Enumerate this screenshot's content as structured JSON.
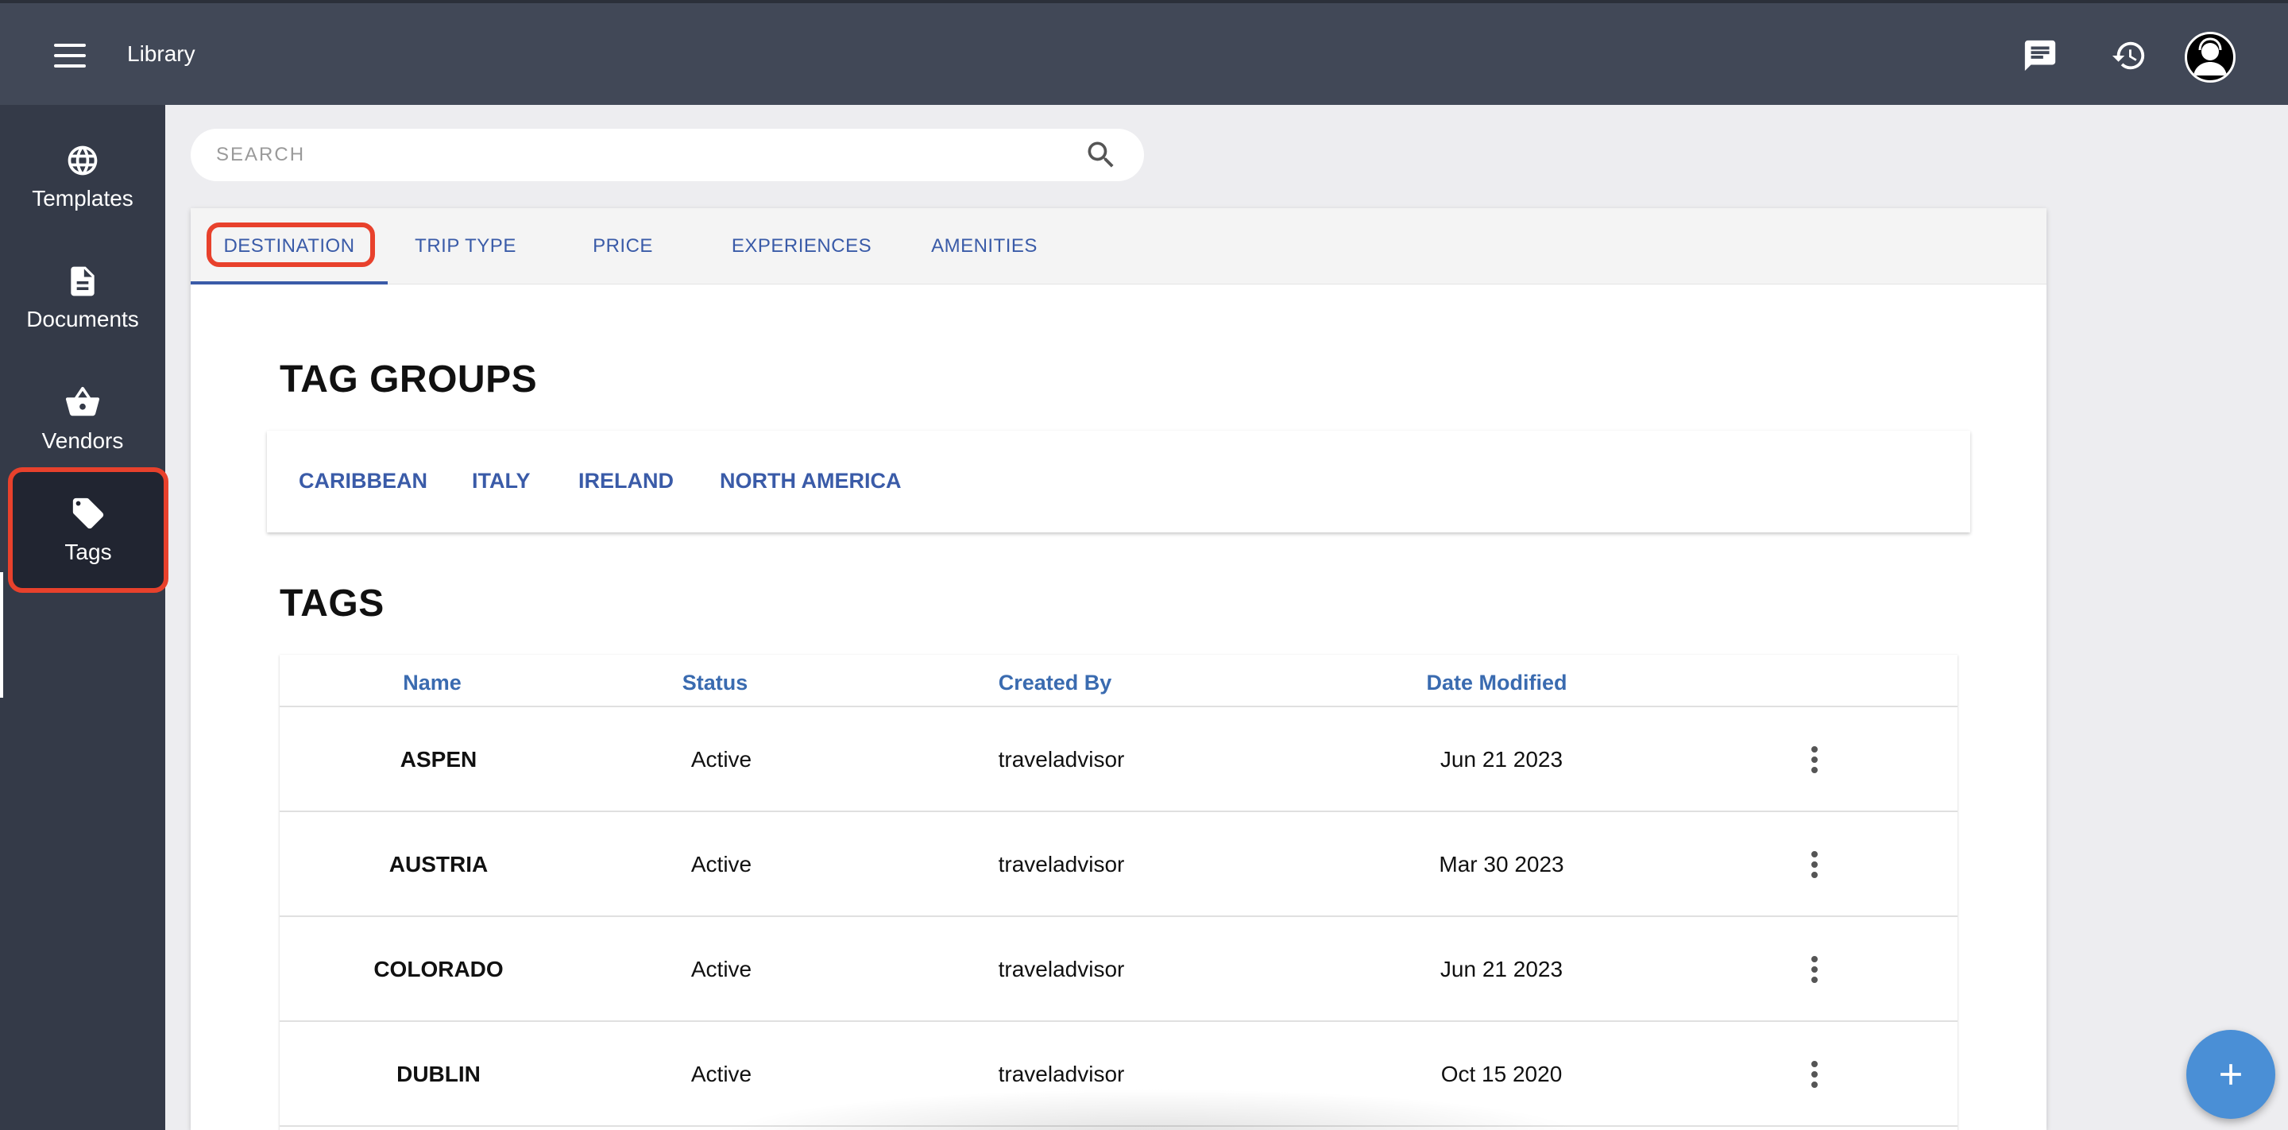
{
  "app": {
    "title": "Library"
  },
  "header": {
    "icons": [
      "menu-icon",
      "chat-icon",
      "history-icon",
      "user-avatar"
    ]
  },
  "sidebar": {
    "items": [
      {
        "label": "Templates",
        "icon": "globe-icon"
      },
      {
        "label": "Documents",
        "icon": "document-icon"
      },
      {
        "label": "Vendors",
        "icon": "basket-icon"
      },
      {
        "label": "Tags",
        "icon": "tag-icon",
        "active": true
      }
    ]
  },
  "search": {
    "placeholder": "SEARCH",
    "value": ""
  },
  "tabs": [
    {
      "label": "DESTINATION",
      "active": true
    },
    {
      "label": "TRIP TYPE"
    },
    {
      "label": "PRICE"
    },
    {
      "label": "EXPERIENCES"
    },
    {
      "label": "AMENITIES"
    }
  ],
  "tag_groups": {
    "title": "TAG GROUPS",
    "items": [
      "CARIBBEAN",
      "ITALY",
      "IRELAND",
      "NORTH AMERICA"
    ]
  },
  "tags": {
    "title": "TAGS",
    "columns": [
      "Name",
      "Status",
      "Created By",
      "Date Modified"
    ],
    "rows": [
      {
        "name": "ASPEN",
        "status": "Active",
        "created_by": "traveladvisor",
        "date_modified": "Jun 21 2023"
      },
      {
        "name": "AUSTRIA",
        "status": "Active",
        "created_by": "traveladvisor",
        "date_modified": "Mar 30 2023"
      },
      {
        "name": "COLORADO",
        "status": "Active",
        "created_by": "traveladvisor",
        "date_modified": "Jun 21 2023"
      },
      {
        "name": "DUBLIN",
        "status": "Active",
        "created_by": "traveladvisor",
        "date_modified": "Oct 15 2020"
      }
    ]
  },
  "colors": {
    "topbar": "#414857",
    "sidebar": "#343a48",
    "accent": "#3a5ba8",
    "highlight": "#e8412c",
    "fab": "#4a8fd6"
  }
}
